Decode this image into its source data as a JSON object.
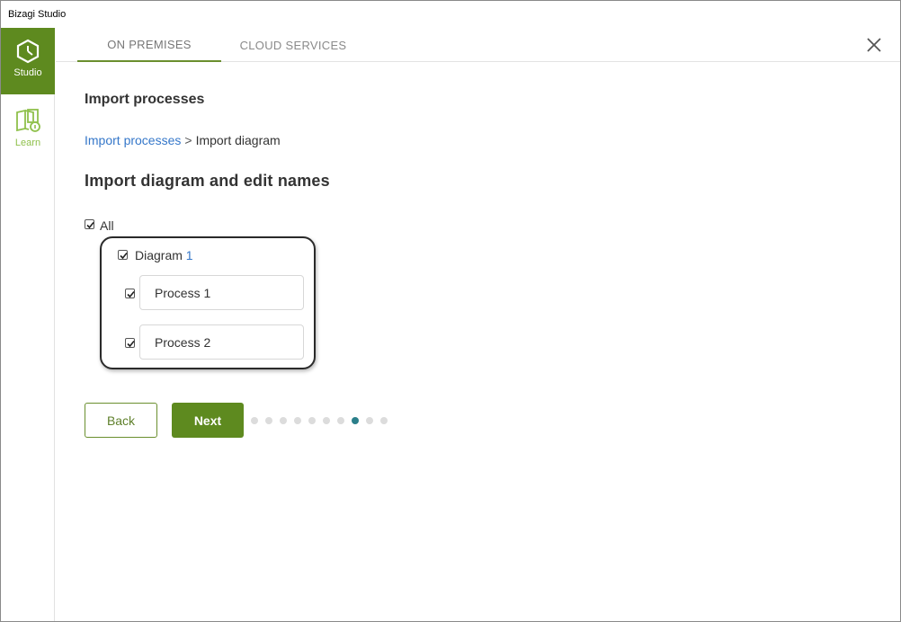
{
  "window": {
    "title": "Bizagi Studio"
  },
  "sidebar": {
    "items": [
      {
        "label": "Studio",
        "icon": "studio-hexagon-icon",
        "active": true
      },
      {
        "label": "Learn",
        "icon": "learn-book-icon",
        "active": false
      }
    ]
  },
  "tabs": [
    {
      "label": "ON PREMISES",
      "active": true
    },
    {
      "label": "CLOUD SERVICES",
      "active": false
    }
  ],
  "close_icon": "close-icon",
  "page": {
    "heading": "Import processes",
    "breadcrumb": {
      "link": "Import processes",
      "separator": ">",
      "current": "Import diagram"
    },
    "section_title": "Import diagram and edit names"
  },
  "tree": {
    "all": {
      "label": "All",
      "checked": true
    },
    "diagram": {
      "label": "Diagram",
      "number": "1",
      "checked": true
    },
    "processes": [
      {
        "value": "Process 1",
        "checked": true
      },
      {
        "value": "Process 2",
        "checked": true
      }
    ]
  },
  "buttons": {
    "back": "Back",
    "next": "Next"
  },
  "wizard": {
    "total_steps": 10,
    "current_step": 8
  },
  "colors": {
    "brand_green": "#5e8a1f",
    "link_blue": "#3577c9",
    "active_dot": "#2b7f8a"
  }
}
